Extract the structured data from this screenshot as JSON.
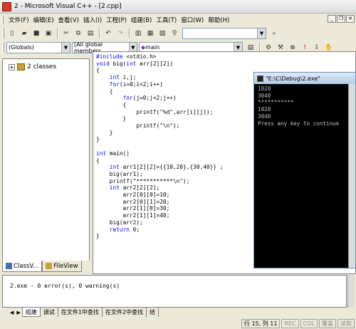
{
  "window": {
    "title": "2 - Microsoft Visual C++ - [2.cpp]"
  },
  "menu": [
    "文件(F)",
    "编辑(E)",
    "查看(V)",
    "插入(I)",
    "工程(P)",
    "组建(B)",
    "工具(T)",
    "窗口(W)",
    "帮助(H)"
  ],
  "toolbar": {
    "globals_combo": "(Globals)",
    "members_combo": "[All global members",
    "function_combo": "main"
  },
  "workspace": {
    "tree_root": "2 classes",
    "tabs": [
      "ClassV...",
      "FileView"
    ]
  },
  "editor": {
    "code": [
      "#include <stdio.h>",
      "void big(int arr[2][2])",
      "{",
      "    int i,j;",
      "    for(i=0;i<2;i++)",
      "    {",
      "        for(j=0;j<2;j++)",
      "        {",
      "            printf(\"%d\",arr[i][j]);",
      "        }",
      "            printf(\"\\n\");",
      "    }",
      "}",
      "",
      "int main()",
      "{",
      "    int arr1[2][2]={{10,20},{30,40}} ;",
      "    big(arr1);",
      "    printf(\"***********\\n\");",
      "    int arr2[2][2];",
      "        arr2[0][0]=10;",
      "        arr2[0][1]=20;",
      "        arr2[1][0]=30;",
      "        arr2[1][1]=40;",
      "    big(arr2);",
      "    return 0;",
      "}"
    ]
  },
  "console": {
    "title": "\"E:\\C\\Debug\\2.exe\"",
    "lines": [
      "1020",
      "3040",
      "***********",
      "1020",
      "3040",
      "Press any key to continue"
    ]
  },
  "output": {
    "text": "2.exe - 0 error(s), 0 warning(s)",
    "tabs": [
      "组建",
      "调试",
      "在文件1中查找",
      "在文件2中查找",
      "结"
    ]
  },
  "status": {
    "position": "行 15, 列 11",
    "indicators": [
      "REC",
      "COL",
      "覆盖",
      "读取"
    ]
  }
}
